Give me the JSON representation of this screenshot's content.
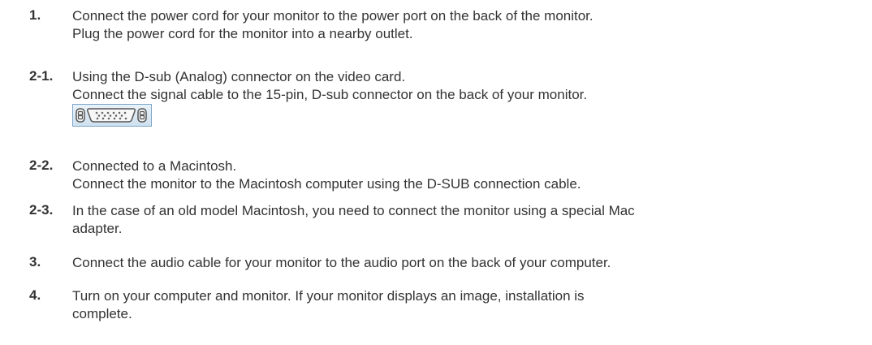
{
  "steps": [
    {
      "number": "1.",
      "lines": [
        "Connect the power cord for your monitor to the power port on the back of the monitor.",
        "Plug the power cord for the monitor into a nearby outlet."
      ]
    },
    {
      "number": "2-1.",
      "lines": [
        "Using the D-sub (Analog) connector on the video card.",
        "Connect the signal cable to the 15-pin, D-sub connector on the back of your monitor."
      ],
      "icon": "d-sub-connector-icon"
    },
    {
      "number": "2-2.",
      "lines": [
        "Connected to a Macintosh.",
        "Connect the monitor to the Macintosh computer using the D-SUB connection cable."
      ]
    },
    {
      "number": "2-3.",
      "lines": [
        "In the case of an old model Macintosh, you need to connect the monitor using a special Mac",
        "adapter."
      ]
    },
    {
      "number": "3.",
      "lines": [
        "Connect the audio cable for your monitor to the audio port on the back of your computer."
      ]
    },
    {
      "number": "4.",
      "lines": [
        "Turn on your computer and monitor. If your monitor displays an image, installation is",
        "complete."
      ]
    }
  ]
}
